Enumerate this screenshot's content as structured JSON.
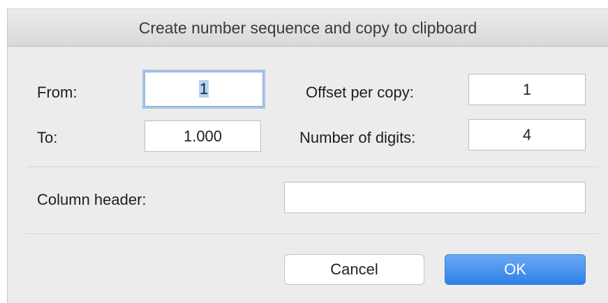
{
  "dialog": {
    "title": "Create number sequence and copy to clipboard"
  },
  "form": {
    "from_label": "From:",
    "from_value": "1",
    "to_label": "To:",
    "to_value": "1.000",
    "offset_label": "Offset per copy:",
    "offset_value": "1",
    "digits_label": "Number of digits:",
    "digits_value": "4",
    "column_header_label": "Column header:",
    "column_header_value": ""
  },
  "buttons": {
    "cancel_label": "Cancel",
    "ok_label": "OK"
  },
  "colors": {
    "accent": "#2f7fe8",
    "focus_ring": "#a8c3e8"
  }
}
